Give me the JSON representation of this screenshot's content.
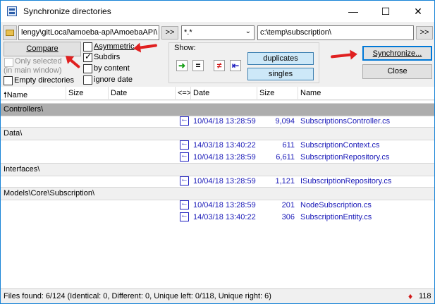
{
  "window": {
    "title": "Synchronize directories",
    "minimize": "—",
    "maximize": "☐",
    "close": "✕"
  },
  "toolbar": {
    "left_path": "lengy\\gitLocal\\amoeba-api\\AmoebaAPI\\",
    "left_browse": ">>",
    "filter": "*.*",
    "right_path": "c:\\temp\\subscription\\",
    "right_browse": ">>"
  },
  "options": {
    "compare": "Compare",
    "only_selected": "Only selected",
    "in_main_window": "(in main window)",
    "empty_directories": "Empty directories",
    "asymmetric": "Asymmetric",
    "subdirs": "Subdirs",
    "by_content": "by content",
    "ignore_date": "ignore date",
    "show": "Show:",
    "duplicates": "duplicates",
    "singles": "singles",
    "synchronize": "Synchronize...",
    "close": "Close"
  },
  "columns": {
    "name_left": "Name",
    "size_left": "Size",
    "date_left": "Date",
    "dir": "<=>",
    "date_right": "Date",
    "size_right": "Size",
    "name_right": "Name"
  },
  "groups": [
    {
      "dir": "Controllers\\",
      "files": [
        {
          "date": "10/04/18 13:28:59",
          "size": "9,094",
          "name": "SubscriptionsController.cs"
        }
      ]
    },
    {
      "dir": "Data\\",
      "files": [
        {
          "date": "14/03/18 13:40:22",
          "size": "611",
          "name": "SubscriptionContext.cs"
        },
        {
          "date": "10/04/18 13:28:59",
          "size": "6,611",
          "name": "SubscriptionRepository.cs"
        }
      ]
    },
    {
      "dir": "Interfaces\\",
      "files": [
        {
          "date": "10/04/18 13:28:59",
          "size": "1,121",
          "name": "ISubscriptionRepository.cs"
        }
      ]
    },
    {
      "dir": "Models\\Core\\Subscription\\",
      "files": [
        {
          "date": "10/04/18 13:28:59",
          "size": "201",
          "name": "NodeSubscription.cs"
        },
        {
          "date": "14/03/18 13:40:22",
          "size": "306",
          "name": "SubscriptionEntity.cs"
        }
      ]
    }
  ],
  "status": {
    "text": "Files found: 6/124  (Identical: 0, Different: 0, Unique left: 0/118, Unique right: 6)",
    "count": "118"
  },
  "colors": {
    "selected_row": "#adadad",
    "file_text": "#1a1ab8",
    "annotation": "#e02020"
  },
  "icons": [
    "app-icon",
    "folder-icon",
    "copy-right-icon",
    "equal-icon",
    "not-equal-icon",
    "copy-left-icon",
    "sort-up-icon",
    "arrow-left-icon",
    "duplicates-icon"
  ]
}
